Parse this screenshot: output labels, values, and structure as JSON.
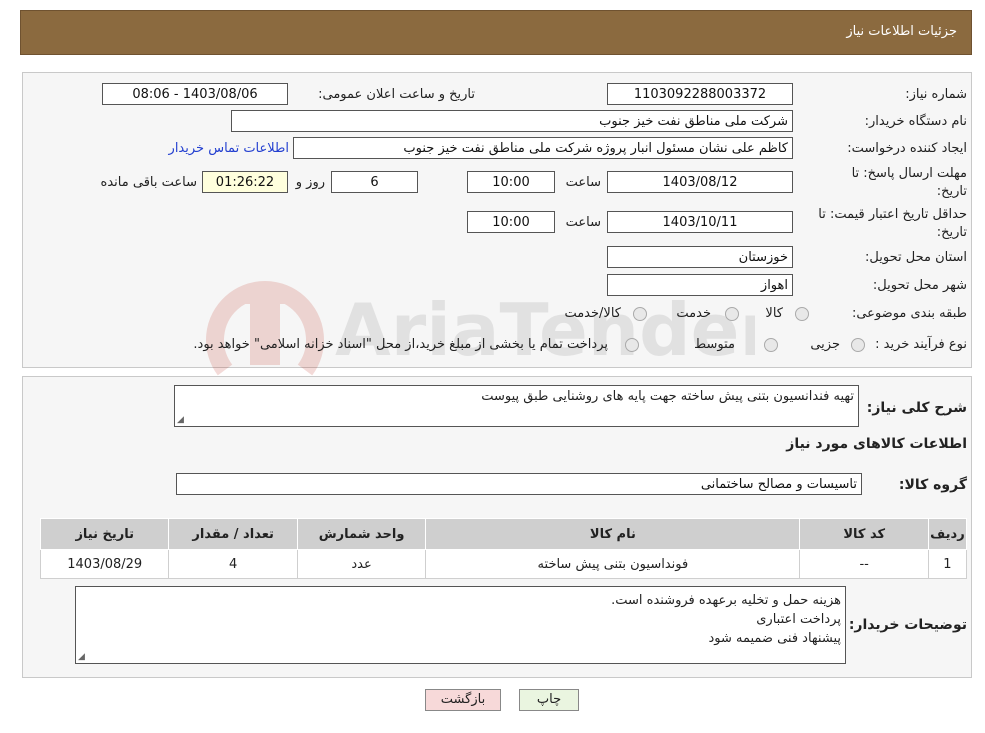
{
  "header": {
    "title": "جزئیات اطلاعات نیاز"
  },
  "form": {
    "need_number_label": "شماره نیاز:",
    "need_number": "1103092288003372",
    "announce_label": "تاریخ و ساعت اعلان عمومی:",
    "announce_value": "1403/08/06 - 08:06",
    "buyer_org_label": "نام دستگاه خریدار:",
    "buyer_org": "شرکت ملی مناطق نفت خیز جنوب",
    "requester_label": "ایجاد کننده درخواست:",
    "requester": "کاظم  علی نشان  مسئول انبار پروژه  شرکت ملی مناطق نفت خیز جنوب",
    "contact_link": "اطلاعات تماس خریدار",
    "deadline_label_1": "مهلت ارسال پاسخ: تا",
    "deadline_label_2": "تاریخ:",
    "deadline_date": "1403/08/12",
    "time_label": "ساعت",
    "deadline_time": "10:00",
    "days_value": "6",
    "days_label": "روز و",
    "remaining_time": "01:26:22",
    "remaining_label": "ساعت باقی مانده",
    "validity_label_1": "حداقل تاریخ اعتبار قیمت: تا",
    "validity_label_2": "تاریخ:",
    "validity_date": "1403/10/11",
    "validity_time": "10:00",
    "province_label": "استان محل تحویل:",
    "province": "خوزستان",
    "city_label": "شهر محل تحویل:",
    "city": "اهواز",
    "category_label": "طبقه بندی موضوعی:",
    "category_options": [
      "کالا",
      "خدمت",
      "کالا/خدمت"
    ],
    "purchase_type_label": "نوع فرآیند خرید :",
    "purchase_options": [
      "جزیی",
      "متوسط"
    ],
    "purchase_note": "پرداخت تمام یا بخشی از مبلغ خرید،از محل \"اسناد خزانه اسلامی\" خواهد بود."
  },
  "details": {
    "summary_label": "شرح کلی نیاز:",
    "summary": "تهیه فندانسیون بتنی پیش ساخته جهت پایه های روشنایی طبق پیوست",
    "goods_info_title": "اطلاعات کالاهای مورد نیاز",
    "goods_group_label": "گروه کالا:",
    "goods_group": "تاسیسات و مصالح ساختمانی",
    "table_headers": [
      "ردیف",
      "کد کالا",
      "نام کالا",
      "واحد شمارش",
      "تعداد / مقدار",
      "تاریخ نیاز"
    ],
    "table_rows": [
      [
        "1",
        "--",
        "فونداسیون بتنی پیش ساخته",
        "عدد",
        "4",
        "1403/08/29"
      ]
    ],
    "buyer_notes_label": "توضیحات خریدار:",
    "buyer_notes": [
      "هزینه حمل و تخلیه برعهده فروشنده است.",
      "پرداخت اعتباری",
      "پیشنهاد فنی ضمیمه شود"
    ]
  },
  "buttons": {
    "print": "چاپ",
    "back": "بازگشت"
  },
  "colors": {
    "header": "#8b6a3f",
    "back_button": "#f7d9d9",
    "link": "#2440d0",
    "print_button": "#eaf5e0"
  }
}
